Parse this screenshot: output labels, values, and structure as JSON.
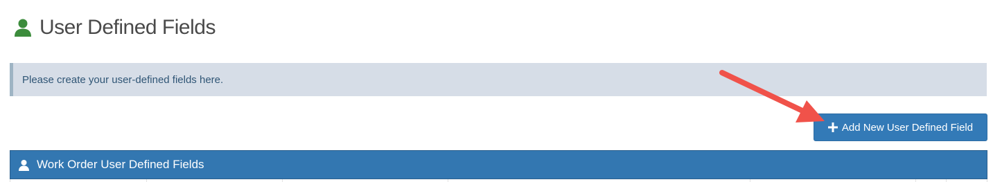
{
  "page": {
    "title": "User Defined Fields",
    "title_icon": "user-icon",
    "accent_color": "#3c8c3c"
  },
  "info": {
    "message": "Please create your user-defined fields here."
  },
  "actions": {
    "add_button_icon": "plus-icon",
    "add_button_label": "Add New User Defined Field",
    "add_button_color": "#337ab7"
  },
  "panel": {
    "icon": "user-icon",
    "title": "Work Order User Defined Fields",
    "color": "#3377b1"
  },
  "annotation": {
    "arrow_color": "#f0524a"
  }
}
